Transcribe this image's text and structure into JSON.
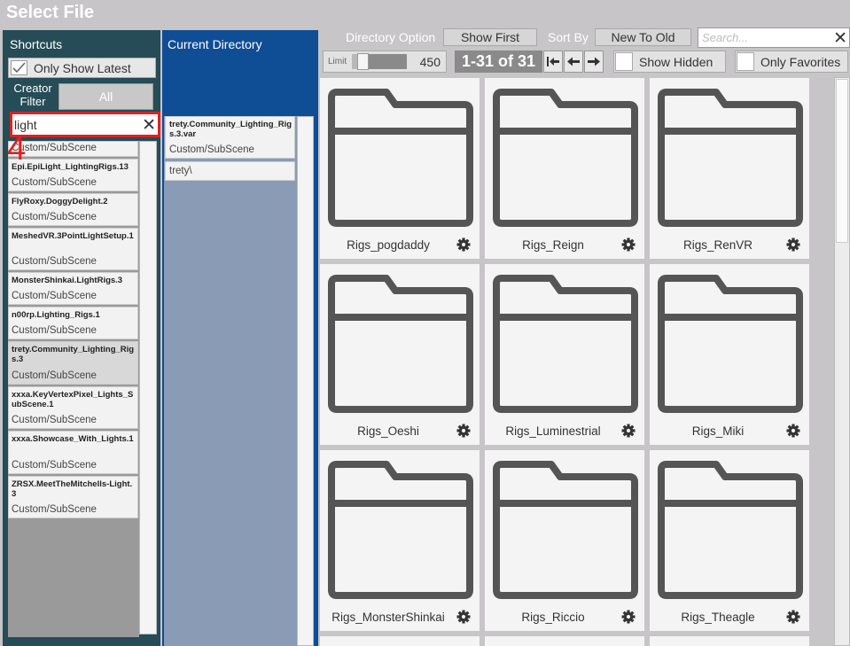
{
  "window": {
    "title": "Select File"
  },
  "shortcuts": {
    "title": "Shortcuts",
    "only_show_latest": "Only Show Latest",
    "creator_filter": "Creator Filter",
    "creator_value": "All",
    "search_value": "light",
    "step_marker": "4",
    "partial_item_type": "Custom/SubScene",
    "items": [
      {
        "name": "Epi.EpiLight_LightingRigs.13",
        "type": "Custom/SubScene"
      },
      {
        "name": "FlyRoxy.DoggyDelight.2",
        "type": "Custom/SubScene"
      },
      {
        "name": "MeshedVR.3PointLightSetup.1",
        "type": "Custom/SubScene"
      },
      {
        "name": "MonsterShinkai.LightRigs.3",
        "type": "Custom/SubScene"
      },
      {
        "name": "n00rp.Lighting_Rigs.1",
        "type": "Custom/SubScene"
      },
      {
        "name": "trety.Community_Lighting_Rigs.3",
        "type": "Custom/SubScene"
      },
      {
        "name": "xxxa.KeyVertexPixel_Lights_SubScene.1",
        "type": "Custom/SubScene"
      },
      {
        "name": "xxxa.Showcase_With_Lights.1",
        "type": "Custom/SubScene"
      },
      {
        "name": "ZRSX.MeetTheMitchells-Light.3",
        "type": "Custom/SubScene"
      }
    ]
  },
  "current_directory": {
    "title": "Current Directory",
    "items": [
      {
        "name": "trety.Community_Lighting_Rigs.3.var",
        "type": "Custom/SubScene"
      },
      {
        "name": "trety\\"
      }
    ]
  },
  "toolbar": {
    "directory_option_label": "Directory Option",
    "directory_option_value": "Show First",
    "sort_by_label": "Sort By",
    "sort_by_value": "New To Old",
    "search_placeholder": "Search...",
    "limit_label": "Limit",
    "limit_value": "450",
    "limit_fraction": 0.12,
    "page_range": "1-31 of 31",
    "show_hidden": "Show Hidden",
    "only_favorites": "Only Favorites"
  },
  "grid": {
    "items": [
      {
        "name": "Rigs_pogdaddy"
      },
      {
        "name": "Rigs_Reign"
      },
      {
        "name": "Rigs_RenVR"
      },
      {
        "name": "Rigs_Oeshi"
      },
      {
        "name": "Rigs_Luminestrial"
      },
      {
        "name": "Rigs_Miki"
      },
      {
        "name": "Rigs_MonsterShinkai"
      },
      {
        "name": "Rigs_Riccio"
      },
      {
        "name": "Rigs_Theagle"
      }
    ]
  },
  "icons": {
    "folder": "folder-icon",
    "gear": "gear-icon",
    "close": "close-icon",
    "check": "checkmark-icon",
    "first_page": "first-page-icon",
    "prev_page": "previous-page-icon",
    "next_page": "next-page-icon"
  },
  "colors": {
    "shortcuts_panel": "#264c57",
    "current_directory_panel": "#0f4d95",
    "highlight": "#e02020",
    "background": "#c7c5c7"
  }
}
